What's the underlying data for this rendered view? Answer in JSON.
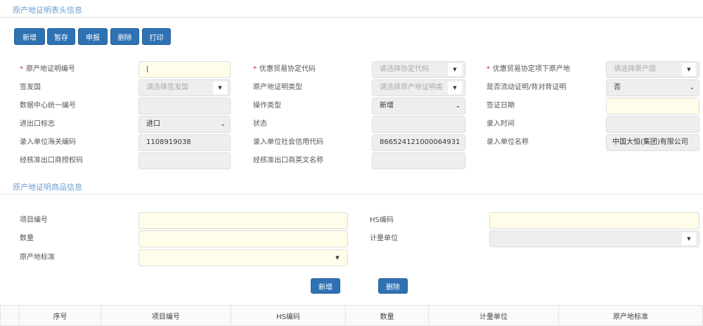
{
  "header_section": {
    "title": "原产地证明表头信息"
  },
  "toolbar": {
    "buttons": [
      "新增",
      "暂存",
      "申报",
      "删除",
      "打印"
    ]
  },
  "form": {
    "cert_no": {
      "label": "原产地证明编号",
      "required": "*",
      "value": "|"
    },
    "agreement_code": {
      "label": "优惠贸易协定代码",
      "required": "*",
      "placeholder": "请选择协定代码"
    },
    "origin_country": {
      "label": "优惠贸易协定项下原产地",
      "required": "*",
      "placeholder": "请选择原产国"
    },
    "issue_country": {
      "label": "签发国",
      "placeholder": "请选择签发国"
    },
    "cert_type": {
      "label": "原产地证明类型",
      "placeholder": "请选择原产地证明类"
    },
    "back_to_back": {
      "label": "是否流动证明/背对背证明",
      "value": "否"
    },
    "data_center_no": {
      "label": "数据中心统一编号",
      "value": ""
    },
    "op_type": {
      "label": "操作类型",
      "value": "新增"
    },
    "visa_date": {
      "label": "签证日期",
      "value": ""
    },
    "ie_flag": {
      "label": "进出口标志",
      "value": "进口"
    },
    "status": {
      "label": "状态",
      "value": ""
    },
    "entry_time": {
      "label": "录入时间",
      "value": ""
    },
    "customs_code": {
      "label": "录入单位海关编码",
      "value": "1108919038"
    },
    "credit_code": {
      "label": "录入单位社会信用代码",
      "value": "866524121000064931"
    },
    "unit_name": {
      "label": "录入单位名称",
      "value": "中国大恒(集团)有限公司"
    },
    "auth_code": {
      "label": "经核准出口商授权码",
      "value": ""
    },
    "exporter_en": {
      "label": "经核准出口商英文名称",
      "value": ""
    }
  },
  "goods_section": {
    "title": "原产地证明商品信息",
    "item_no": {
      "label": "项目编号"
    },
    "hs": {
      "label": "HS编码"
    },
    "qty": {
      "label": "数量"
    },
    "unit": {
      "label": "计量单位"
    },
    "std": {
      "label": "原产地标准"
    },
    "add": "新增",
    "delete": "删除"
  },
  "table": {
    "headers": [
      "",
      "序号",
      "项目编号",
      "HS编码",
      "数量",
      "计量单位",
      "原产地标准"
    ]
  }
}
